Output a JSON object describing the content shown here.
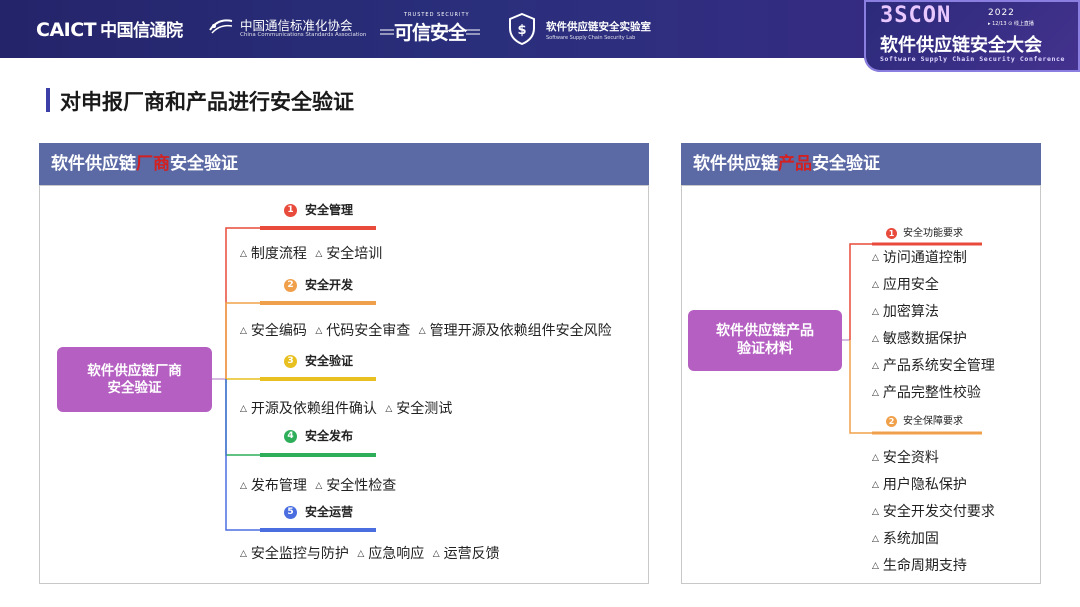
{
  "header": {
    "caict_en": "CAICT",
    "caict_cn": "中国信通院",
    "ccsa_cn": "中国通信标准化协会",
    "ccsa_en": "China Communications Standards Association",
    "trusted_top": "TRUSTED SECURITY",
    "trusted_cn": "可信安全",
    "lab_cn": "软件供应链安全实验室",
    "lab_en": "Software Supply Chain Security Lab",
    "conf_logo": "3SCON",
    "conf_year": "2022",
    "conf_date": "▸ 12/13  ⊙ 线上直播",
    "conf_cn": "软件供应链安全大会",
    "conf_en": "Software Supply Chain Security Conference"
  },
  "page_title": "对申报厂商和产品进行安全验证",
  "left_panel": {
    "title_pre": "软件供应链",
    "title_hl": "厂商",
    "title_post": "安全验证",
    "center_line1": "软件供应链厂商",
    "center_line2": "安全验证",
    "branches": [
      {
        "num": "1",
        "title": "安全管理",
        "color": "#e84a3c",
        "items": [
          "制度流程",
          "安全培训"
        ]
      },
      {
        "num": "2",
        "title": "安全开发",
        "color": "#f0a04a",
        "items": [
          "安全编码",
          "代码安全审查",
          "管理开源及依赖组件安全风险"
        ]
      },
      {
        "num": "3",
        "title": "安全验证",
        "color": "#e8c020",
        "items": [
          "开源及依赖组件确认",
          "安全测试"
        ]
      },
      {
        "num": "4",
        "title": "安全发布",
        "color": "#2fae5a",
        "items": [
          "发布管理",
          "安全性检查"
        ]
      },
      {
        "num": "5",
        "title": "安全运营",
        "color": "#4a6ee0",
        "items": [
          "安全监控与防护",
          "应急响应",
          "运营反馈"
        ]
      }
    ]
  },
  "right_panel": {
    "title_pre": "软件供应链",
    "title_hl": "产品",
    "title_post": "安全验证",
    "center_line1": "软件供应链产品",
    "center_line2": "验证材料",
    "group1": {
      "num": "1",
      "title": "安全功能要求",
      "color": "#e84a3c",
      "items": [
        "访问通道控制",
        "应用安全",
        "加密算法",
        "敏感数据保护",
        "产品系统安全管理",
        "产品完整性校验"
      ]
    },
    "group2": {
      "num": "2",
      "title": "安全保障要求",
      "color": "#f0a04a",
      "items": [
        "安全资料",
        "用户隐私保护",
        "安全开发交付要求",
        "系统加固",
        "生命周期支持"
      ]
    }
  },
  "colors": {
    "banner": "#2a2f7c",
    "panel_header": "#5b69a5",
    "center_node": "#b55fc2",
    "highlight": "#d32020"
  }
}
